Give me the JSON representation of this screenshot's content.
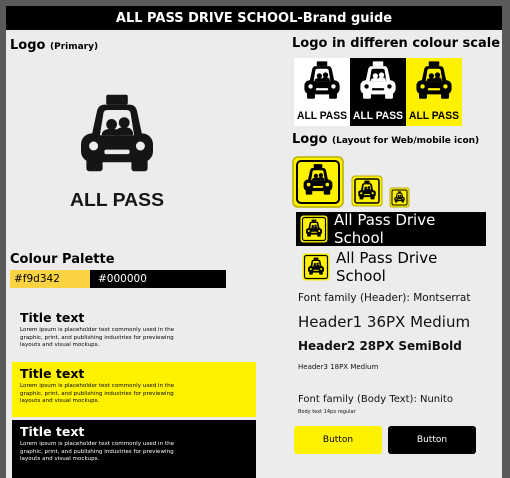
{
  "header": {
    "title": "ALL PASS DRIVE SCHOOL-Brand guide"
  },
  "logo_section": {
    "title": "Logo",
    "subtitle": "(Primary)",
    "wordmark": "ALL PASS"
  },
  "colour_scale": {
    "title": "Logo in differen colour scale",
    "variants": [
      {
        "bg": "#ffffff",
        "fg": "#000000",
        "word": "ALL PASS"
      },
      {
        "bg": "#000000",
        "fg": "#ffffff",
        "word": "ALL PASS"
      },
      {
        "bg": "#fff200",
        "fg": "#000000",
        "word": "ALL PASS"
      }
    ]
  },
  "web_icon": {
    "title": "Logo",
    "subtitle": "(Layout for Web/mobile icon)",
    "lockup_text": "All Pass Drive School"
  },
  "palette": {
    "title": "Colour Palette",
    "colors": [
      {
        "label": "#f9d342",
        "hex": "#f9d342"
      },
      {
        "label": "#000000",
        "hex": "#000000"
      }
    ]
  },
  "samples": [
    {
      "title": "Title text",
      "body": "Lorem ipsum is placeholder text commonly used in the graphic, print, and publishing industries for previewing layouts and visual mockups."
    },
    {
      "title": "Title text",
      "body": "Lorem ipsum is placeholder text commonly used in the graphic, print, and publishing industries for previewing layouts and visual mockups."
    },
    {
      "title": "Title text",
      "body": "Lorem ipsum is placeholder text commonly used in the graphic, print, and publishing industries for previewing layouts and visual mockups."
    }
  ],
  "typography": {
    "header_family": "Font family (Header): Montserrat",
    "h1": "Header1 36PX Medium",
    "h2": "Header2 28PX SemiBold",
    "h3": "Header3 18PX Medium",
    "body_family": "Font family (Body Text): Nunito",
    "body": "Body text 14px  regular"
  },
  "buttons": {
    "primary": "Button",
    "secondary": "Button"
  },
  "colors": {
    "brand_yellow": "#fff200",
    "black": "#000000"
  }
}
